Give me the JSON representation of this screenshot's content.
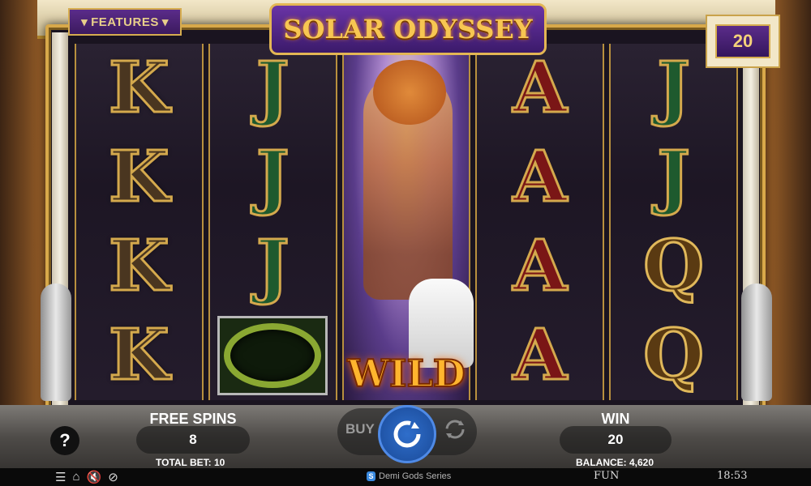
{
  "header": {
    "features_label": "FEATURES",
    "game_title": "SOLAR ODYSSEY",
    "lines_count": "20"
  },
  "reels": [
    [
      "K",
      "K",
      "K",
      "K"
    ],
    [
      "J",
      "J",
      "J",
      "wreath"
    ],
    [
      "WILD"
    ],
    [
      "A",
      "A",
      "A",
      "A"
    ],
    [
      "J",
      "J",
      "Q",
      "Q"
    ]
  ],
  "wild_label": "WILD",
  "bottom": {
    "help_label": "?",
    "free_spins_label": "FREE SPINS",
    "free_spins_value": "8",
    "total_bet_label": "TOTAL BET: 10",
    "buy_label": "BUY",
    "win_label": "WIN",
    "win_value": "20",
    "balance_label": "BALANCE: 4,620"
  },
  "footer": {
    "brand": "Demi Gods Series",
    "brand_mark": "S",
    "mode": "FUN",
    "time": "18:53",
    "icons": [
      "menu-icon",
      "home-icon",
      "sound-off-icon",
      "speed-icon"
    ]
  },
  "colors": {
    "accent_gold": "#d8a94a",
    "panel_purple": "#5b2c8a",
    "spin_blue": "#2f6ecb"
  }
}
